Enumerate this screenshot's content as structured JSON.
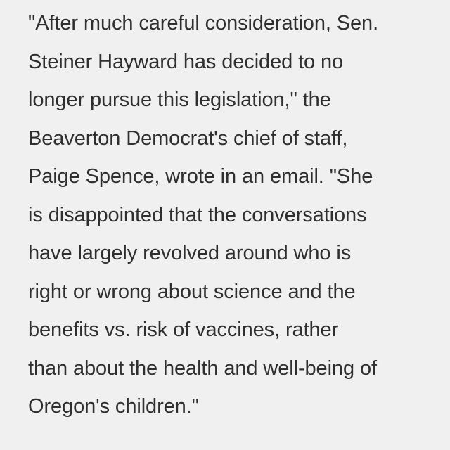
{
  "article": {
    "quote_lines": [
      "\"After much careful consideration, Sen.",
      "Steiner Hayward has decided to no",
      "longer pursue this legislation,\" the",
      "Beaverton Democrat's chief of staff,",
      "Paige Spence, wrote in an email. \"She",
      "is disappointed that the conversations",
      "have largely revolved around who is",
      "right or wrong about science and the",
      "benefits vs. risk of vaccines, rather",
      "than about the health and well-being of",
      "Oregon's children.\""
    ]
  }
}
